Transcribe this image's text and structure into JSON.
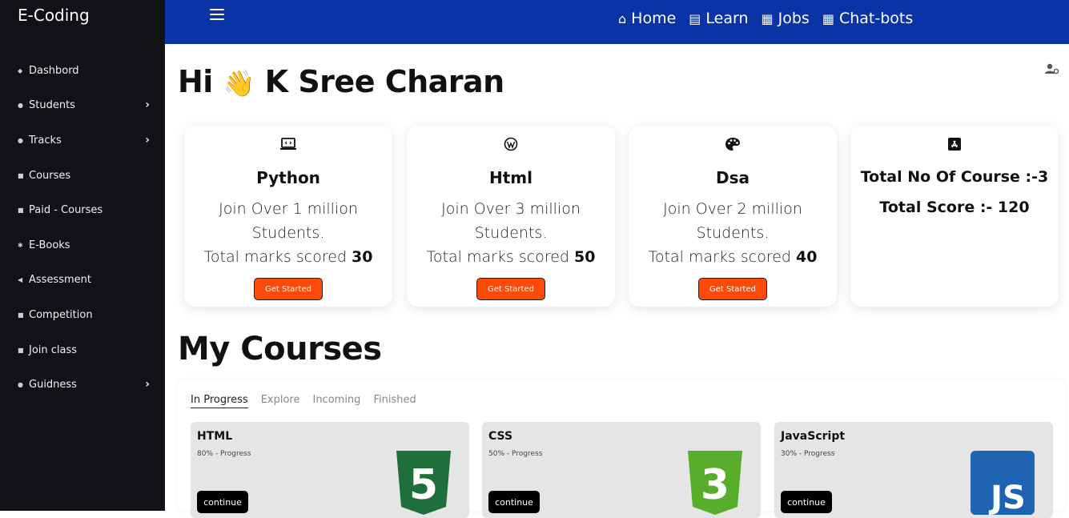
{
  "sidebar": {
    "brand": "E-Coding",
    "items": [
      {
        "label": "Dashbord",
        "icon": "dashboard-icon",
        "chevron": ""
      },
      {
        "label": "Students",
        "icon": "database-icon",
        "chevron": "›"
      },
      {
        "label": "Tracks",
        "icon": "database-icon",
        "chevron": "›"
      },
      {
        "label": "Courses",
        "icon": "courses-icon",
        "chevron": ""
      },
      {
        "label": "Paid - Courses",
        "icon": "courses-icon",
        "chevron": ""
      },
      {
        "label": "E-Books",
        "icon": "ebooks-icon",
        "chevron": ""
      },
      {
        "label": "Assessment",
        "icon": "assessment-icon",
        "chevron": ""
      },
      {
        "label": "Competition",
        "icon": "lock-icon",
        "chevron": ""
      },
      {
        "label": "Join class",
        "icon": "lock-icon",
        "chevron": ""
      },
      {
        "label": "Guidness",
        "icon": "database-icon",
        "chevron": "›"
      }
    ]
  },
  "topnav": {
    "home": "Home",
    "learn": "Learn",
    "jobs": "Jobs",
    "chatbots": "Chat-bots"
  },
  "greeting": {
    "hi": "Hi",
    "wave": "👋",
    "name": "K Sree Charan"
  },
  "cards": [
    {
      "title": "Python",
      "desc": "Join Over 1 million Students.",
      "marks_label": "Total marks scored",
      "marks": "30",
      "button": "Get Started",
      "icon": "laptop-code-icon"
    },
    {
      "title": "Html",
      "desc": "Join Over 3 million Students.",
      "marks_label": "Total marks scored",
      "marks": "50",
      "button": "Get Started",
      "icon": "wordpress-icon"
    },
    {
      "title": "Dsa",
      "desc": "Join Over 2 million Students.",
      "marks_label": "Total marks scored",
      "marks": "40",
      "button": "Get Started",
      "icon": "palette-icon"
    }
  ],
  "summary": {
    "icon": "app-store-icon",
    "total_courses": "Total No Of Course :-3",
    "total_score": "Total Score :- 120"
  },
  "my_courses": {
    "title": "My Courses",
    "tabs": [
      "In Progress",
      "Explore",
      "Incoming",
      "Finished"
    ],
    "active_tab": "In Progress",
    "items": [
      {
        "name": "HTML",
        "progress": "80% - Progress",
        "button": "continue",
        "logo": "html5-logo",
        "logo_text": "5"
      },
      {
        "name": "CSS",
        "progress": "50% - Progress",
        "button": "continue",
        "logo": "css3-logo",
        "logo_text": "3"
      },
      {
        "name": "JavaScript",
        "progress": "30% - Progress",
        "button": "continue",
        "logo": "js-logo",
        "logo_text": "JS"
      }
    ]
  },
  "colors": {
    "sidebar_bg": "#111216",
    "topbar_bg": "#0a33a6",
    "button_bg": "#fc4a0b",
    "html5": "#1f6f3a",
    "css3": "#58ad2a",
    "js": "#1e64b3"
  }
}
